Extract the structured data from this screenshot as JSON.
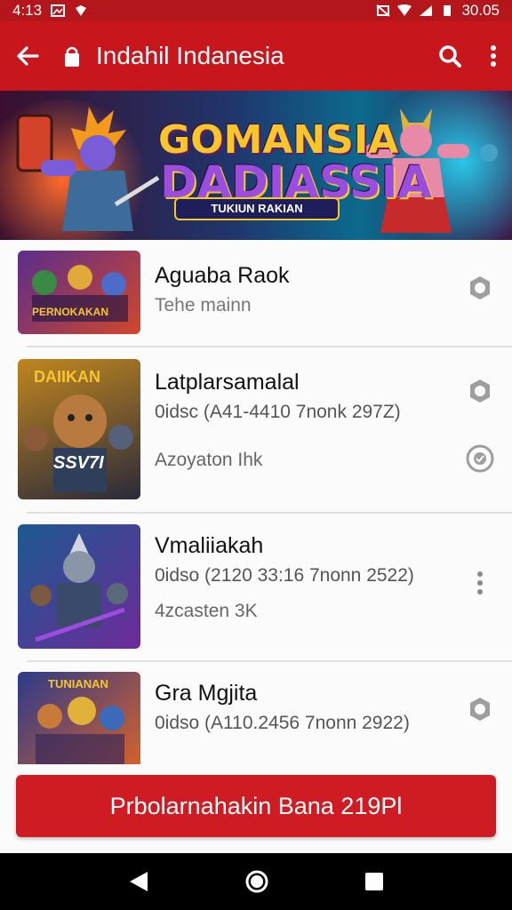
{
  "status_bar": {
    "time": "4:13",
    "battery": "30.05"
  },
  "app_bar": {
    "title": "Indahil Indanesia"
  },
  "banner": {
    "title_top": "GOMANSIA",
    "title_bottom": "DADIASSIA",
    "ribbon": "TUKIUN RAKIAN"
  },
  "items": [
    {
      "name": "Aguaba Raok",
      "meta": "Tehe mainn",
      "sub": "",
      "action_icon": "settings-icon",
      "thumb_text": "PERNOKAKAN"
    },
    {
      "name": "Latplarsamalal",
      "meta": "0idsc (A41-4410 7nonk 297Z)",
      "sub": "Azoyaton Ihk",
      "action_icon": "settings-icon",
      "action2_icon": "check-circle-icon",
      "thumb_text": "DAIIKAN",
      "thumb_badge": "SSV7I"
    },
    {
      "name": "Vmaliiakah",
      "meta": "0idso (2120 33:16 7nonn 2522)",
      "sub": "4zcasten 3K",
      "action_icon": "more-vert-icon",
      "thumb_text": ""
    },
    {
      "name": "Gra Mgjita",
      "meta": "0idso (A110.2456 7nonn 2922)",
      "sub": "",
      "action_icon": "settings-icon",
      "thumb_text": "TUNIANAN"
    }
  ],
  "cta": {
    "label": "Prbolarnahakin Bana 219Pl"
  },
  "colors": {
    "primary": "#c8161d",
    "primary_dark": "#b3161b",
    "cta": "#cf1b22"
  }
}
